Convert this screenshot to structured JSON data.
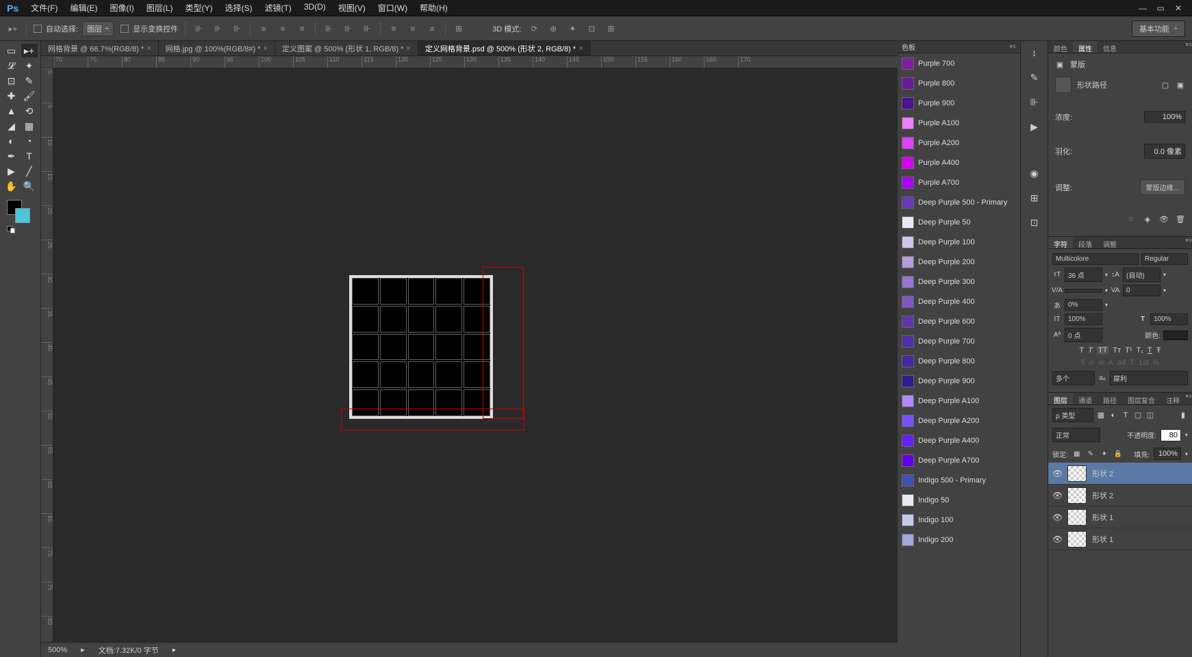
{
  "app": {
    "logo": "Ps"
  },
  "menus": [
    "文件(F)",
    "编辑(E)",
    "图像(I)",
    "图层(L)",
    "类型(Y)",
    "选择(S)",
    "滤镜(T)",
    "3D(D)",
    "视图(V)",
    "窗口(W)",
    "帮助(H)"
  ],
  "options": {
    "auto_select": "自动选择:",
    "layer_select": "图层",
    "show_transform": "显示变换控件",
    "mode_3d": "3D 模式:",
    "workspace": "基本功能"
  },
  "tabs": [
    {
      "label": "网格背景 @ 66.7%(RGB/8) *",
      "active": false
    },
    {
      "label": "网格.jpg @ 100%(RGB/8#) *",
      "active": false
    },
    {
      "label": "定义图案 @ 500% (形状 1, RGB/8) *",
      "active": false
    },
    {
      "label": "定义网格背景.psd @ 500% (形状 2, RGB/8) *",
      "active": true
    }
  ],
  "ruler_h": [
    "75",
    "80",
    "85",
    "90",
    "95",
    "100"
  ],
  "status": {
    "zoom": "500%",
    "doc": "文档:7.32K/0 字节"
  },
  "swatch_title": "色板",
  "swatches": [
    {
      "name": "Purple 700",
      "c": "#7b1fa2"
    },
    {
      "name": "Purple 800",
      "c": "#6a1b9a"
    },
    {
      "name": "Purple 900",
      "c": "#4a148c"
    },
    {
      "name": "Purple A100",
      "c": "#ea80fc"
    },
    {
      "name": "Purple A200",
      "c": "#e040fb"
    },
    {
      "name": "Purple A400",
      "c": "#d500f9"
    },
    {
      "name": "Purple A700",
      "c": "#aa00ff"
    },
    {
      "name": "Deep Purple 500 - Primary",
      "c": "#673ab7"
    },
    {
      "name": "Deep Purple 50",
      "c": "#ede7f6"
    },
    {
      "name": "Deep Purple 100",
      "c": "#d1c4e9"
    },
    {
      "name": "Deep Purple 200",
      "c": "#b39ddb"
    },
    {
      "name": "Deep Purple 300",
      "c": "#9575cd"
    },
    {
      "name": "Deep Purple 400",
      "c": "#7e57c2"
    },
    {
      "name": "Deep Purple 600",
      "c": "#5e35b1"
    },
    {
      "name": "Deep Purple 700",
      "c": "#512da8"
    },
    {
      "name": "Deep Purple 800",
      "c": "#4527a0"
    },
    {
      "name": "Deep Purple 900",
      "c": "#311b92"
    },
    {
      "name": "Deep Purple A100",
      "c": "#b388ff"
    },
    {
      "name": "Deep Purple A200",
      "c": "#7c4dff"
    },
    {
      "name": "Deep Purple A400",
      "c": "#651fff"
    },
    {
      "name": "Deep Purple A700",
      "c": "#6200ea"
    },
    {
      "name": "Indigo 500 - Primary",
      "c": "#3f51b5"
    },
    {
      "name": "Indigo 50",
      "c": "#e8eaf6"
    },
    {
      "name": "Indigo 100",
      "c": "#c5cae9"
    },
    {
      "name": "Indigo 200",
      "c": "#9fa8da"
    }
  ],
  "prop": {
    "tabs": [
      "颜色",
      "属性",
      "信息"
    ],
    "mask_title": "蒙版",
    "shape_path": "形状路径",
    "density_label": "浓度:",
    "density_val": "100%",
    "feather_label": "羽化:",
    "feather_val": "0.0 像素",
    "adjust_label": "调整:",
    "mask_edge": "蒙版边缘..."
  },
  "char": {
    "tabs": [
      "字符",
      "段落",
      "调整"
    ],
    "font": "Multicolore",
    "style": "Regular",
    "size": "36 点",
    "line": "(自动)",
    "va": "0",
    "scale": "0%",
    "h": "100%",
    "v": "100%",
    "baseline": "0 点",
    "color_label": "颜色:",
    "aa_label": "多个",
    "aa_method": "犀利"
  },
  "layers": {
    "tabs": [
      "图层",
      "通道",
      "路径",
      "图层复合",
      "注释"
    ],
    "kind": "ρ 类型",
    "blend": "正常",
    "opacity_label": "不透明度:",
    "opacity_val": "80",
    "lock_label": "锁定:",
    "fill_label": "填充:",
    "fill_val": "100%",
    "items": [
      {
        "name": "形状 2",
        "selected": true
      },
      {
        "name": "形状 2",
        "selected": false
      },
      {
        "name": "形状 1",
        "selected": false
      },
      {
        "name": "形状 1",
        "selected": false
      }
    ]
  }
}
